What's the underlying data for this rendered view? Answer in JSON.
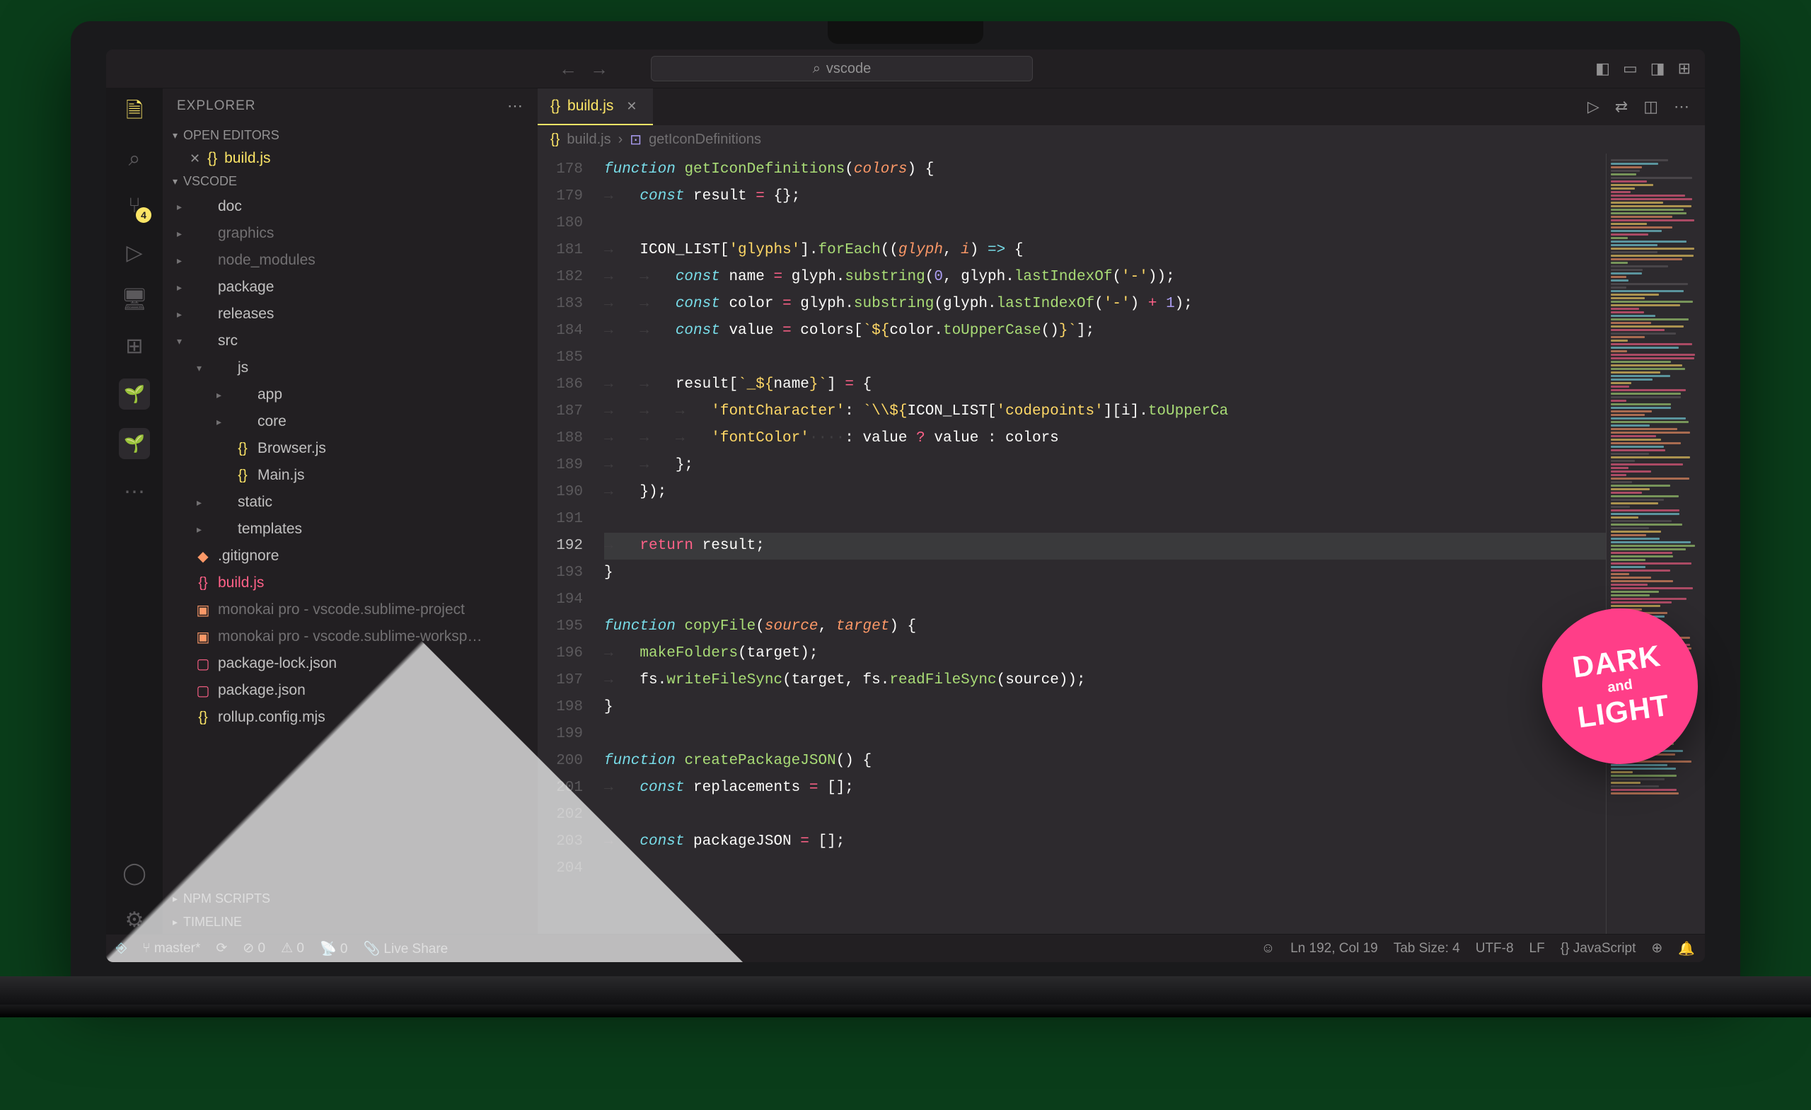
{
  "titlebar": {
    "search_placeholder": "vscode"
  },
  "activitybar": {
    "scm_badge": "4"
  },
  "sidebar": {
    "title": "EXPLORER",
    "open_editors_label": "OPEN EDITORS",
    "open_editor_file": "build.js",
    "project_label": "VSCODE",
    "npm_scripts_label": "NPM SCRIPTS",
    "timeline_label": "TIMELINE",
    "tree": [
      {
        "depth": 0,
        "type": "folder",
        "open": false,
        "label": "doc"
      },
      {
        "depth": 0,
        "type": "folder",
        "open": false,
        "label": "graphics",
        "dim": true
      },
      {
        "depth": 0,
        "type": "folder",
        "open": false,
        "label": "node_modules",
        "dim": true
      },
      {
        "depth": 0,
        "type": "folder",
        "open": false,
        "label": "package"
      },
      {
        "depth": 0,
        "type": "folder",
        "open": false,
        "label": "releases"
      },
      {
        "depth": 0,
        "type": "folder",
        "open": true,
        "label": "src"
      },
      {
        "depth": 1,
        "type": "folder",
        "open": true,
        "label": "js"
      },
      {
        "depth": 2,
        "type": "folder",
        "open": false,
        "label": "app"
      },
      {
        "depth": 2,
        "type": "folder",
        "open": false,
        "label": "core"
      },
      {
        "depth": 2,
        "type": "file",
        "icon": "js",
        "label": "Browser.js",
        "color": "#fce566"
      },
      {
        "depth": 2,
        "type": "file",
        "icon": "js",
        "label": "Main.js",
        "color": "#fce566"
      },
      {
        "depth": 1,
        "type": "folder",
        "open": false,
        "label": "static"
      },
      {
        "depth": 1,
        "type": "folder",
        "open": false,
        "label": "templates"
      },
      {
        "depth": 0,
        "type": "file",
        "icon": "git",
        "label": ".gitignore",
        "color": "#fc9867"
      },
      {
        "depth": 0,
        "type": "file",
        "icon": "js",
        "label": "build.js",
        "sel": true,
        "color": "#ff6188"
      },
      {
        "depth": 0,
        "type": "file",
        "icon": "subl",
        "label": "monokai pro - vscode.sublime-project",
        "dim": true,
        "color": "#fc9867"
      },
      {
        "depth": 0,
        "type": "file",
        "icon": "subl",
        "label": "monokai pro - vscode.sublime-worksp…",
        "dim": true,
        "color": "#fc9867"
      },
      {
        "depth": 0,
        "type": "file",
        "icon": "json",
        "label": "package-lock.json",
        "color": "#ff6188"
      },
      {
        "depth": 0,
        "type": "file",
        "icon": "json",
        "label": "package.json",
        "color": "#ff6188"
      },
      {
        "depth": 0,
        "type": "file",
        "icon": "js",
        "label": "rollup.config.mjs",
        "color": "#fce566"
      }
    ]
  },
  "editor": {
    "tab_label": "build.js",
    "breadcrumb_file": "build.js",
    "breadcrumb_symbol": "getIconDefinitions",
    "line_start": 178,
    "current_line": 192,
    "lines": [
      "<span class='kw'>function</span> <span class='fn'>getIconDefinitions</span>(<span class='pr'>colors</span>) {",
      "<span class='ws'>→   </span><span class='kw'>const</span> <span class='id'>result</span> <span class='op'>=</span> {};",
      "",
      "<span class='ws'>→   </span><span class='id'>ICON_LIST</span>[<span class='st'>'glyphs'</span>].<span class='fn'>forEach</span>((<span class='pr'>glyph</span>, <span class='pr'>i</span>) <span class='kw'>=&gt;</span> {",
      "<span class='ws'>→   →   </span><span class='kw'>const</span> <span class='id'>name</span> <span class='op'>=</span> <span class='id'>glyph</span>.<span class='fn'>substring</span>(<span class='nm'>0</span>, <span class='id'>glyph</span>.<span class='fn'>lastIndexOf</span>(<span class='st'>'-'</span>));",
      "<span class='ws'>→   →   </span><span class='kw'>const</span> <span class='id'>color</span> <span class='op'>=</span> <span class='id'>glyph</span>.<span class='fn'>substring</span>(<span class='id'>glyph</span>.<span class='fn'>lastIndexOf</span>(<span class='st'>'-'</span>) <span class='op'>+</span> <span class='nm'>1</span>);",
      "<span class='ws'>→   →   </span><span class='kw'>const</span> <span class='id'>value</span> <span class='op'>=</span> <span class='id'>colors</span>[<span class='st'>`${</span><span class='id'>color</span>.<span class='fn'>toUpperCase</span>()<span class='st'>}`</span>];",
      "",
      "<span class='ws'>→   →   </span><span class='id'>result</span>[<span class='st'>`_${</span><span class='id'>name</span><span class='st'>}`</span>] <span class='op'>=</span> {",
      "<span class='ws'>→   →   →   </span><span class='st'>'fontCharacter'</span>: <span class='st'>`\\\\${</span><span class='id'>ICON_LIST</span>[<span class='st'>'codepoints'</span>][<span class='id'>i</span>].<span class='fn'>toUpperCa</span>",
      "<span class='ws'>→   →   →   </span><span class='st'>'fontColor'</span><span class='ws'>····</span>: <span class='id'>value</span> <span class='op'>?</span> <span class='id'>value</span> : <span class='id'>colors</span>",
      "<span class='ws'>→   →   </span>};",
      "<span class='ws'>→   </span>});",
      "",
      "<span class='ws'>→   </span><span class='kr'>return</span> <span class='id'>result</span>;",
      "}",
      "",
      "<span class='kw'>function</span> <span class='fn'>copyFile</span>(<span class='pr'>source</span>, <span class='pr'>target</span>) {",
      "<span class='ws'>→   </span><span class='fn'>makeFolders</span>(<span class='id'>target</span>);",
      "<span class='ws'>→   </span><span class='id'>fs</span>.<span class='fn'>writeFileSync</span>(<span class='id'>target</span>, <span class='id'>fs</span>.<span class='fn'>readFileSync</span>(<span class='id'>source</span>));",
      "}",
      "",
      "<span class='kw'>function</span> <span class='fn'>createPackageJSON</span>() {",
      "<span class='ws'>→   </span><span class='kw'>const</span> <span class='id'>replacements</span> <span class='op'>=</span> [];",
      "",
      "<span class='ws'>→   </span><span class='kw'>const</span> <span class='id'>packageJSON</span> <span class='op'>=</span> [];",
      ""
    ]
  },
  "status": {
    "remote_icon": "⎋",
    "branch": "master*",
    "errors": "0",
    "warnings": "0",
    "radio": "0",
    "live_share": "Live Share",
    "ln_col": "Ln 192, Col 19",
    "tab_size": "Tab Size: 4",
    "encoding": "UTF-8",
    "eol": "LF",
    "lang": "JavaScript"
  },
  "badge": {
    "line1": "DARK",
    "line2": "and",
    "line3": "LIGHT"
  }
}
